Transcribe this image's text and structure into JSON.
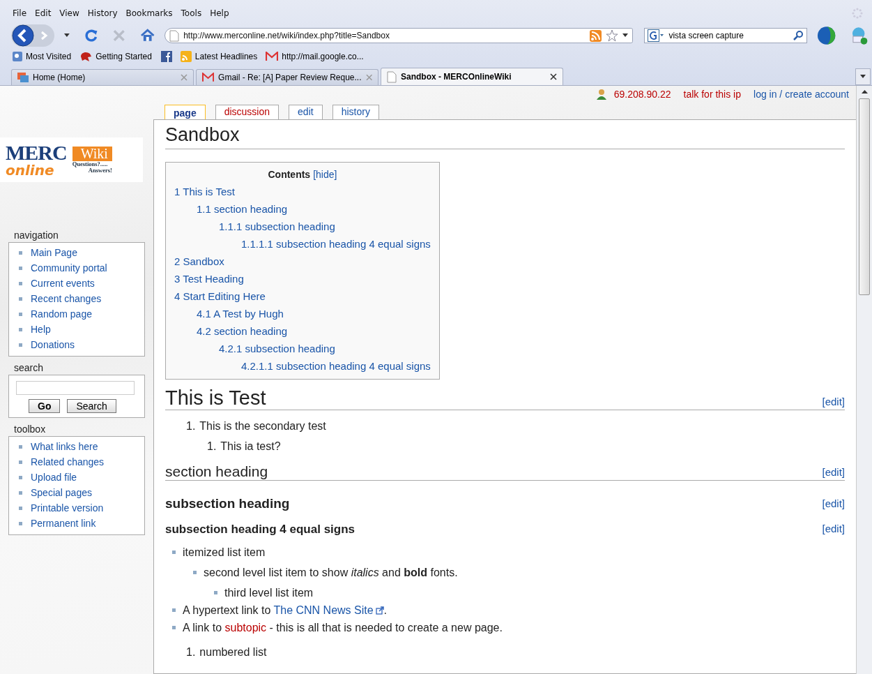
{
  "menu": [
    "File",
    "Edit",
    "View",
    "History",
    "Bookmarks",
    "Tools",
    "Help"
  ],
  "address": {
    "value": "http://www.merconline.net/wiki/index.php?title=Sandbox"
  },
  "search_bar": {
    "value": "vista screen capture"
  },
  "bookmarks": [
    "Most Visited",
    "Getting Started",
    "Latest Headlines",
    "http://mail.google.co..."
  ],
  "tabs": [
    {
      "label": "Home (Home)",
      "selected": false
    },
    {
      "label": "Gmail - Re: [A] Paper Review Reque...",
      "selected": false
    },
    {
      "label": "Sandbox - MERCOnlineWiki",
      "selected": true
    }
  ],
  "user_links": {
    "ip": "69.208.90.22",
    "talk": "talk for this ip",
    "login": "log in / create account"
  },
  "logo": {
    "merc": "MERC",
    "online": "online",
    "wiki": "Wiki",
    "tagline_1": "Questions?.....",
    "tagline_2": "Answers!"
  },
  "page_tabs": [
    {
      "label": "page",
      "selected": true,
      "kind": "exists"
    },
    {
      "label": "discussion",
      "selected": false,
      "kind": "new"
    },
    {
      "label": "edit",
      "selected": false,
      "kind": "exists"
    },
    {
      "label": "history",
      "selected": false,
      "kind": "exists"
    }
  ],
  "title": "Sandbox",
  "navigation": {
    "title": "navigation",
    "items": [
      "Main Page",
      "Community portal",
      "Current events",
      "Recent changes",
      "Random page",
      "Help",
      "Donations"
    ]
  },
  "search": {
    "title": "search",
    "buttons": [
      "Go",
      "Search"
    ]
  },
  "toolbox": {
    "title": "toolbox",
    "items": [
      "What links here",
      "Related changes",
      "Upload file",
      "Special pages",
      "Printable version",
      "Permanent link"
    ]
  },
  "toc": {
    "title": "Contents",
    "toggle": "[hide]",
    "entries": [
      {
        "number": "1",
        "text": "This is Test",
        "children": [
          {
            "number": "1.1",
            "text": "section heading",
            "children": [
              {
                "number": "1.1.1",
                "text": "subsection heading",
                "children": [
                  {
                    "number": "1.1.1.1",
                    "text": "subsection heading 4 equal signs"
                  }
                ]
              }
            ]
          }
        ]
      },
      {
        "number": "2",
        "text": "Sandbox"
      },
      {
        "number": "3",
        "text": "Test Heading"
      },
      {
        "number": "4",
        "text": "Start Editing Here",
        "children": [
          {
            "number": "4.1",
            "text": "A Test by Hugh"
          },
          {
            "number": "4.2",
            "text": "section heading",
            "children": [
              {
                "number": "4.2.1",
                "text": "subsection heading",
                "children": [
                  {
                    "number": "4.2.1.1",
                    "text": "subsection heading 4 equal signs"
                  }
                ]
              }
            ]
          }
        ]
      }
    ]
  },
  "body": [
    {
      "kind": "h2",
      "text": "This is Test",
      "edit": "[edit]"
    },
    {
      "kind": "ol",
      "items": [
        {
          "marker": "1.",
          "parts": [
            {
              "text": "This is the secondary test"
            }
          ],
          "children": [
            {
              "marker": "1.",
              "parts": [
                {
                  "text": "This ia test?"
                }
              ]
            }
          ]
        }
      ]
    },
    {
      "kind": "h3",
      "text": "section heading",
      "edit": "[edit]"
    },
    {
      "kind": "h4",
      "text": "subsection heading",
      "edit": "[edit]"
    },
    {
      "kind": "h5",
      "text": "subsection heading 4 equal signs",
      "edit": "[edit]"
    },
    {
      "kind": "ul",
      "items": [
        {
          "parts": [
            {
              "text": "itemized list item"
            }
          ],
          "children": [
            {
              "parts": [
                {
                  "text": "second level list item to show *italics* and **bold** fonts."
                }
              ],
              "children": [
                {
                  "parts": [
                    {
                      "text": "third level list item"
                    }
                  ]
                }
              ]
            }
          ]
        },
        {
          "parts": [
            {
              "text": "A hypertext link to "
            },
            {
              "link": "The CNN News Site",
              "kind": "external"
            },
            {
              "text": "."
            }
          ]
        },
        {
          "parts": [
            {
              "text": "A link to "
            },
            {
              "link": "subtopic",
              "kind": "new"
            },
            {
              "text": " - this is all that is needed to create a new page."
            }
          ]
        }
      ]
    },
    {
      "kind": "ol",
      "items": [
        {
          "marker": "1.",
          "parts": [
            {
              "text": "numbered list"
            }
          ]
        }
      ]
    }
  ]
}
